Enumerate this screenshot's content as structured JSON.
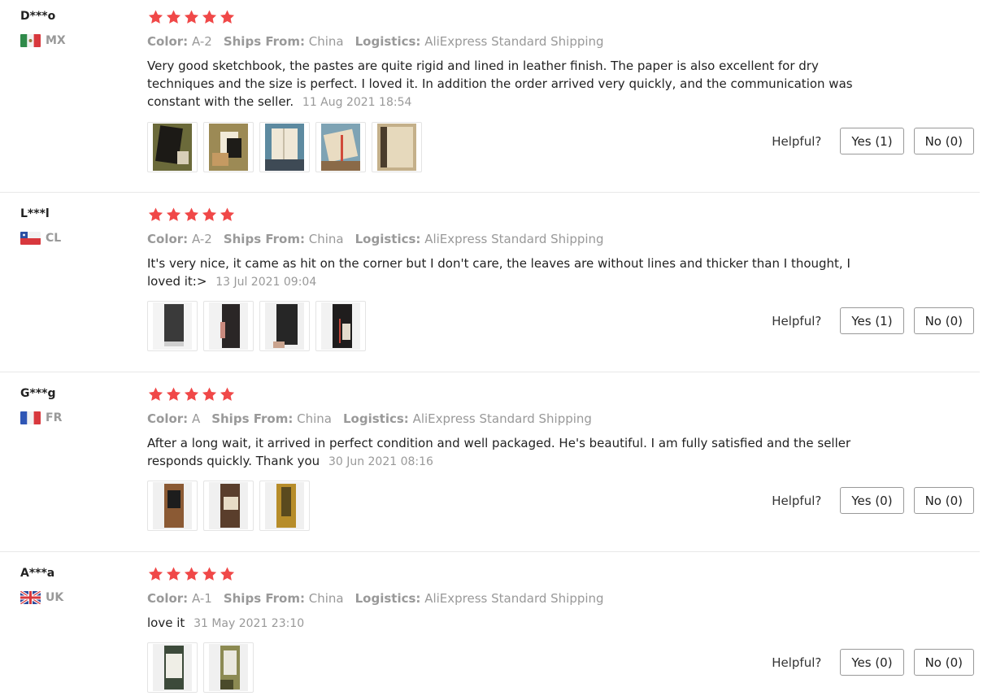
{
  "labels": {
    "color": "Color:",
    "ships_from": "Ships From:",
    "logistics": "Logistics:",
    "helpful": "Helpful?"
  },
  "star_color": "#f04848",
  "reviews": [
    {
      "user": "D***o",
      "country": "MX",
      "rating": 5,
      "color_value": "A-2",
      "ships_from_value": "China",
      "logistics_value": "AliExpress Standard Shipping",
      "text": "Very good sketchbook, the pastes are quite rigid and lined in leather finish. The paper is also excellent for dry techniques and the size is perfect. I loved it. In addition the order arrived very quickly, and the communication was constant with the seller.",
      "date": "11 Aug 2021 18:54",
      "photo_count": 5,
      "yes": "Yes (1)",
      "no": "No (0)"
    },
    {
      "user": "L***l",
      "country": "CL",
      "rating": 5,
      "color_value": "A-2",
      "ships_from_value": "China",
      "logistics_value": "AliExpress Standard Shipping",
      "text": "It's very nice, it came as hit on the corner but I don't care, the leaves are without lines and thicker than I thought, I loved it:>",
      "date": "13 Jul 2021 09:04",
      "photo_count": 4,
      "yes": "Yes (1)",
      "no": "No (0)"
    },
    {
      "user": "G***g",
      "country": "FR",
      "rating": 5,
      "color_value": "A",
      "ships_from_value": "China",
      "logistics_value": "AliExpress Standard Shipping",
      "text": "After a long wait, it arrived in perfect condition and well packaged. He's beautiful. I am fully satisfied and the seller responds quickly. Thank you",
      "date": "30 Jun 2021 08:16",
      "photo_count": 3,
      "yes": "Yes (0)",
      "no": "No (0)"
    },
    {
      "user": "A***a",
      "country": "UK",
      "rating": 5,
      "color_value": "A-1",
      "ships_from_value": "China",
      "logistics_value": "AliExpress Standard Shipping",
      "text": "love it",
      "date": "31 May 2021 23:10",
      "photo_count": 2,
      "yes": "Yes (0)",
      "no": "No (0)"
    }
  ]
}
